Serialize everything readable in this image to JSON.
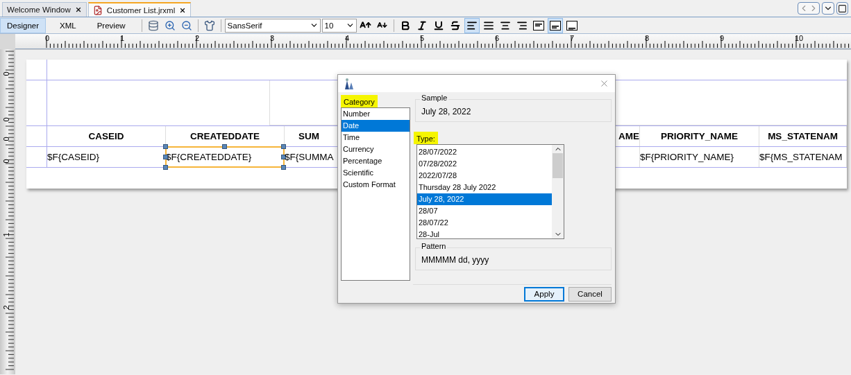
{
  "tabs": [
    {
      "label": "Welcome Window",
      "selected": false,
      "kind": "plain"
    },
    {
      "label": "Customer List.jrxml",
      "selected": true,
      "kind": "report"
    }
  ],
  "view_tabs": [
    {
      "label": "Designer",
      "selected": true
    },
    {
      "label": "XML",
      "selected": false
    },
    {
      "label": "Preview",
      "selected": false
    }
  ],
  "font_field": {
    "value": "SansSerif"
  },
  "size_field": {
    "value": "10"
  },
  "alignment_buttons": [
    {
      "kind": "left",
      "selected": true
    },
    {
      "kind": "justify",
      "selected": false
    },
    {
      "kind": "center",
      "selected": false
    },
    {
      "kind": "right",
      "selected": false
    }
  ],
  "vertical_buttons": [
    {
      "kind": "top",
      "selected": false
    },
    {
      "kind": "middle",
      "selected": true
    },
    {
      "kind": "bottom",
      "selected": false
    }
  ],
  "ruler": {
    "labels": [
      "0",
      "1",
      "2",
      "3",
      "4",
      "5",
      "6",
      "7",
      "8",
      "9",
      "10"
    ],
    "side_labels": [
      "0",
      "0",
      "0",
      "0",
      "1",
      "2"
    ]
  },
  "report": {
    "columns": [
      {
        "header": "CASEID",
        "field": "$F{CASEID}",
        "selected": false
      },
      {
        "header": "CREATEDDATE",
        "field": "$F{CREATEDDATE}",
        "selected": true
      },
      {
        "header": "SUM",
        "field": "$F{SUMMA",
        "selected": false
      },
      {
        "header": "AME",
        "selected": false
      },
      {
        "header": "PRIORITY_NAME",
        "field": "$F{PRIORITY_NAME}",
        "selected": false
      },
      {
        "header": "MS_STATENAM",
        "field": "$F{MS_STATENAM",
        "selected": false
      }
    ]
  },
  "dialog": {
    "category_label": {
      "text": "Category",
      "highlighted": true
    },
    "categories": [
      {
        "label": "Number",
        "selected": false
      },
      {
        "label": "Date",
        "selected": true
      },
      {
        "label": "Time",
        "selected": false
      },
      {
        "label": "Currency",
        "selected": false
      },
      {
        "label": "Percentage",
        "selected": false
      },
      {
        "label": "Scientific",
        "selected": false
      },
      {
        "label": "Custom Format",
        "selected": false
      }
    ],
    "sample": {
      "title": "Sample",
      "value": "July 28, 2022"
    },
    "type_label": {
      "text": "Type:",
      "highlighted": true
    },
    "types": [
      {
        "label": "28/07/2022",
        "selected": false
      },
      {
        "label": "07/28/2022",
        "selected": false
      },
      {
        "label": "2022/07/28",
        "selected": false
      },
      {
        "label": "Thursday 28 July 2022",
        "selected": false
      },
      {
        "label": "July 28, 2022",
        "selected": true
      },
      {
        "label": "28/07",
        "selected": false
      },
      {
        "label": "28/07/22",
        "selected": false
      },
      {
        "label": "28-Jul",
        "selected": false
      }
    ],
    "pattern": {
      "title": "Pattern",
      "value": "MMMMM dd, yyyy"
    },
    "buttons": [
      {
        "label": "Apply",
        "default": true
      },
      {
        "label": "Cancel",
        "default": false
      }
    ]
  }
}
